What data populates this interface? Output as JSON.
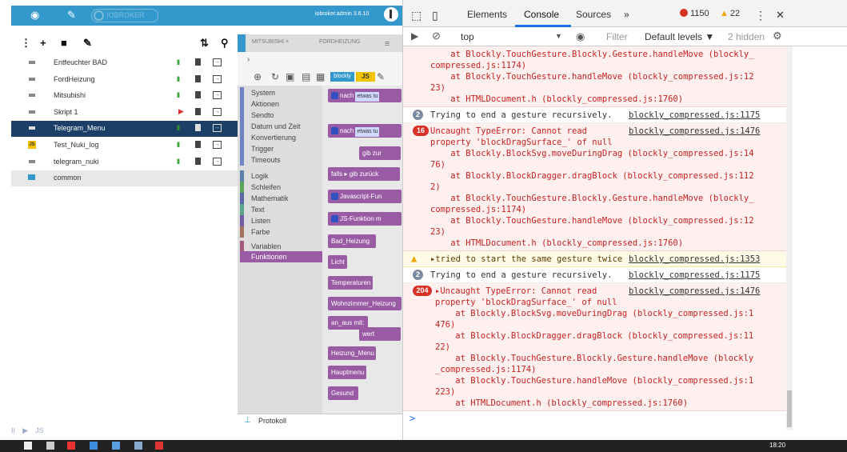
{
  "app": {
    "logo_text": "IOBROKER",
    "admin_label": "iobroker.admin 3.6.10"
  },
  "scripts": [
    {
      "name": "Entfeuchter BAD",
      "type": "blockly",
      "state": "running"
    },
    {
      "name": "FordHeizung",
      "type": "blockly",
      "state": "running"
    },
    {
      "name": "Mitsubishi",
      "type": "blockly",
      "state": "running"
    },
    {
      "name": "Skript 1",
      "type": "blockly",
      "state": "stopped"
    },
    {
      "name": "Telegram_Menu",
      "type": "blockly",
      "state": "running",
      "selected": true
    },
    {
      "name": "Test_Nuki_log",
      "type": "js",
      "state": "running"
    },
    {
      "name": "telegram_nuki",
      "type": "blockly",
      "state": "running"
    },
    {
      "name": "common",
      "type": "folder"
    }
  ],
  "list_icons": {
    "pause": "II",
    "play": "▶",
    "trash": "trash-icon",
    "export": "export-icon",
    "js_badge": "JS"
  },
  "editor": {
    "tabs": [
      "MITSUBISHI ×",
      "FORDHEIZUNG"
    ],
    "blockly_label": "blockly",
    "js_label": "JS",
    "protokoll": "Protokoll",
    "categories": [
      {
        "label": "System",
        "color": "#6e83c4"
      },
      {
        "label": "Aktionen",
        "color": "#6e83c4"
      },
      {
        "label": "Sendto",
        "color": "#6e83c4"
      },
      {
        "label": "Datum und Zeit",
        "color": "#6e83c4"
      },
      {
        "label": "Konvertierung",
        "color": "#6e83c4"
      },
      {
        "label": "Trigger",
        "color": "#6e83c4"
      },
      {
        "label": "Timeouts",
        "color": "#6e83c4"
      },
      {
        "label": "Logik",
        "color": "#5b80a5"
      },
      {
        "label": "Schleifen",
        "color": "#5ba55b"
      },
      {
        "label": "Mathematik",
        "color": "#5b67a5"
      },
      {
        "label": "Text",
        "color": "#5ba58c"
      },
      {
        "label": "Listen",
        "color": "#745ba5"
      },
      {
        "label": "Farbe",
        "color": "#a5745b"
      },
      {
        "label": "Variablen",
        "color": "#a55b80"
      },
      {
        "label": "Funktionen",
        "color": "#9a5ba5",
        "selected": true
      }
    ],
    "blocks": [
      {
        "text": "nach",
        "chip": "etwas tu",
        "gear": true
      },
      {
        "text": "nach",
        "chip": "etwas tu",
        "gear": true
      },
      {
        "text": "gib zur"
      },
      {
        "text": "falls ▸ gib zurück"
      },
      {
        "text": "Javascript-Fun",
        "gear": true
      },
      {
        "text": "JS-Funktion m",
        "gear": true
      },
      {
        "text": "Bad_Heizung"
      },
      {
        "text": "Licht"
      },
      {
        "text": "Temperaturen"
      },
      {
        "text": "Wohnzimmer_Heizung"
      },
      {
        "text": "an_aus mit:"
      },
      {
        "text": "wert"
      },
      {
        "text": "Heizung_Menu"
      },
      {
        "text": "Hauptmenu"
      },
      {
        "text": "Gesund"
      }
    ]
  },
  "devtools": {
    "tabs": [
      "Elements",
      "Console",
      "Sources",
      "»"
    ],
    "error_count": "1150",
    "warning_count": "22",
    "context": "top",
    "filter_placeholder": "Filter",
    "levels": "Default levels ▼",
    "hidden": "2 hidden",
    "close": "✕",
    "messages": [
      {
        "kind": "err",
        "lines": [
          "    at Blockly.TouchGesture.Blockly.Gesture.handleMove (blockly_",
          "compressed.js:1174)",
          "    at Blockly.TouchGesture.handleMove (blockly_compressed.js:12",
          "23)",
          "    at HTMLDocument.h (blockly_compressed.js:1760)"
        ]
      },
      {
        "kind": "info",
        "badge": "2",
        "lines": [
          "Trying to end a gesture recursively."
        ],
        "src": "blockly_compressed.js:1175"
      },
      {
        "kind": "err",
        "badge": "16",
        "lines": [
          "Uncaught TypeError: Cannot read",
          "property 'blockDragSurface_' of null",
          "    at Blockly.BlockSvg.moveDuringDrag (blockly_compressed.js:14",
          "76)",
          "    at Blockly.BlockDragger.dragBlock (blockly_compressed.js:112",
          "2)",
          "    at Blockly.TouchGesture.Blockly.Gesture.handleMove (blockly_",
          "compressed.js:1174)",
          "    at Blockly.TouchGesture.handleMove (blockly_compressed.js:12",
          "23)",
          "    at HTMLDocument.h (blockly_compressed.js:1760)"
        ],
        "src": "blockly_compressed.js:1476"
      },
      {
        "kind": "warn",
        "lines": [
          "▸tried to start the same gesture twice"
        ],
        "src": "blockly_compressed.js:1353"
      },
      {
        "kind": "info",
        "badge": "2",
        "lines": [
          "Trying to end a gesture recursively."
        ],
        "src": "blockly_compressed.js:1175"
      },
      {
        "kind": "err",
        "badge": "204",
        "lines": [
          "▸Uncaught TypeError: Cannot read",
          "property 'blockDragSurface_' of null",
          "    at Blockly.BlockSvg.moveDuringDrag (blockly_compressed.js:1",
          "476)",
          "    at Blockly.BlockDragger.dragBlock (blockly_compressed.js:11",
          "22)",
          "    at Blockly.TouchGesture.Blockly.Gesture.handleMove (blockly",
          "_compressed.js:1174)",
          "    at Blockly.TouchGesture.handleMove (blockly_compressed.js:1",
          "223)",
          "    at HTMLDocument.h (blockly_compressed.js:1760)"
        ],
        "src": "blockly_compressed.js:1476"
      }
    ],
    "prompt": ">"
  },
  "taskbar": {
    "clock": "18:20"
  },
  "colors": {
    "accent": "#3399cc",
    "selected_row": "#1b3f66",
    "error": "#d93025",
    "warning": "#f2a600"
  }
}
